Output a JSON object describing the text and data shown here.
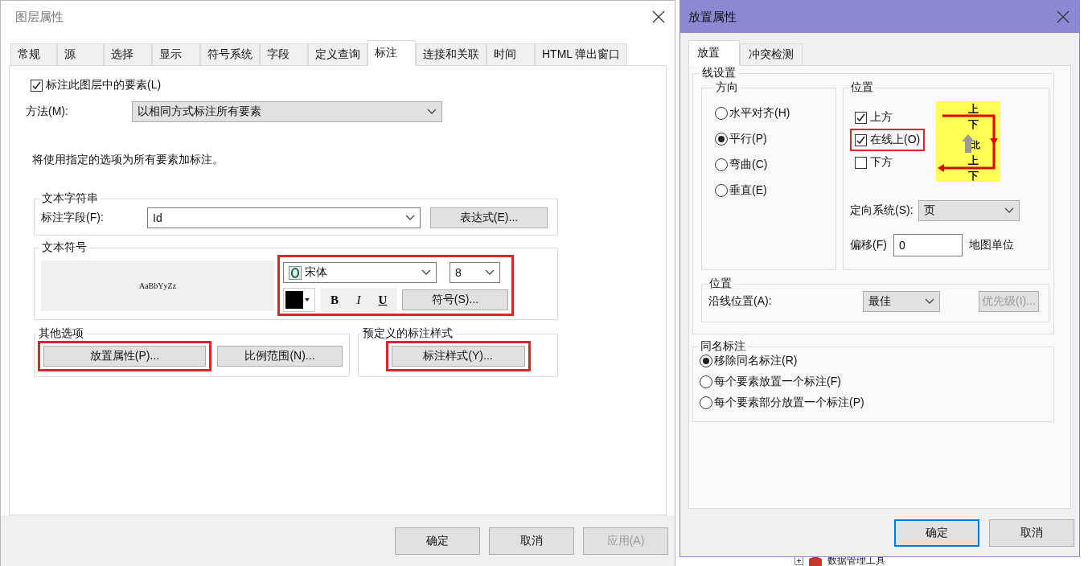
{
  "layer_dialog": {
    "title": "图层属性",
    "tabs": [
      {
        "label": "常规",
        "selected": false
      },
      {
        "label": "源",
        "selected": false
      },
      {
        "label": "选择",
        "selected": false
      },
      {
        "label": "显示",
        "selected": false
      },
      {
        "label": "符号系统",
        "selected": false
      },
      {
        "label": "字段",
        "selected": false
      },
      {
        "label": "定义查询",
        "selected": false
      },
      {
        "label": "标注",
        "selected": true
      },
      {
        "label": "连接和关联",
        "selected": false
      },
      {
        "label": "时间",
        "selected": false
      },
      {
        "label": "HTML 弹出窗口",
        "selected": false
      }
    ],
    "label_features": {
      "label": "标注此图层中的要素(L)",
      "checked": true
    },
    "method": {
      "label": "方法(M):",
      "value": "以相同方式标注所有要素"
    },
    "description": "将使用指定的选项为所有要素加标注。",
    "text_string": {
      "title": "文本字符串",
      "field_label": "标注字段(F):",
      "field_value": "Id",
      "expression_button": "表达式(E)..."
    },
    "text_symbol": {
      "title": "文本符号",
      "preview": "AaBbYyZz",
      "highlighted": true,
      "font": "宋体",
      "size": "8",
      "bold": "B",
      "italic": "I",
      "underline": "U",
      "symbol_button": "符号(S)..."
    },
    "other_options": {
      "title": "其他选项",
      "buttons": [
        {
          "label": "放置属性(P)...",
          "highlighted": true
        },
        {
          "label": "比例范围(N)...",
          "highlighted": false
        }
      ]
    },
    "predefined_styles": {
      "title": "预定义的标注样式",
      "button": {
        "label": "标注样式(Y)...",
        "highlighted": true
      }
    },
    "buttons": [
      {
        "label": "确定",
        "disabled": false
      },
      {
        "label": "取消",
        "disabled": false
      },
      {
        "label": "应用(A)",
        "disabled": true
      }
    ]
  },
  "placement_dialog": {
    "title": "放置属性",
    "tabs": [
      {
        "label": "放置",
        "selected": true
      },
      {
        "label": "冲突检测",
        "selected": false
      }
    ],
    "line_settings": {
      "title": "线设置",
      "orientation": {
        "title": "方向",
        "options": [
          {
            "label": "水平对齐(H)",
            "selected": false
          },
          {
            "label": "平行(P)",
            "selected": true
          },
          {
            "label": "弯曲(C)",
            "selected": false
          },
          {
            "label": "垂直(E)",
            "selected": false
          }
        ]
      },
      "position": {
        "title": "位置",
        "options": [
          {
            "label": "上方",
            "checked": true,
            "highlighted": false
          },
          {
            "label": "在线上(O)",
            "checked": true,
            "highlighted": true
          },
          {
            "label": "下方",
            "checked": false,
            "highlighted": false
          }
        ],
        "diagram_labels": [
          "上",
          "下",
          "北",
          "上",
          "下"
        ],
        "orientation_system": {
          "label": "定向系统(S):",
          "value": "页"
        },
        "offset": {
          "label": "偏移(F)",
          "value": "0",
          "unit": "地图单位"
        }
      },
      "along_line": {
        "title": "位置",
        "label": "沿线位置(A):",
        "value": "最佳",
        "priority_button": {
          "label": "优先级(I)...",
          "disabled": true
        }
      }
    },
    "duplicate_labels": {
      "title": "同名标注",
      "options": [
        {
          "label": "移除同名标注(R)",
          "selected": true
        },
        {
          "label": "每个要素放置一个标注(F)",
          "selected": false
        },
        {
          "label": "每个要素部分放置一个标注(P)",
          "selected": false
        }
      ]
    },
    "buttons": [
      {
        "label": "确定",
        "focused": true
      },
      {
        "label": "取消",
        "focused": false
      }
    ]
  },
  "background_item": {
    "label": "数据管理工具"
  }
}
